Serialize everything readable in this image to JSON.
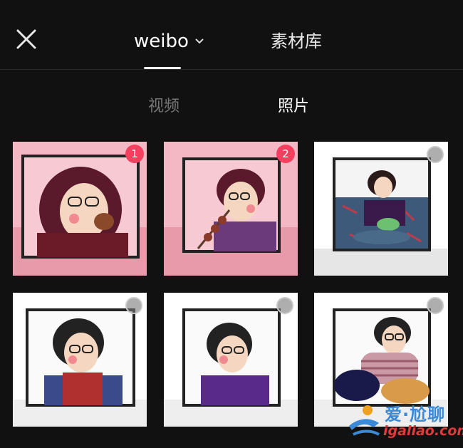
{
  "header": {
    "close_icon": "close-icon",
    "tabs": [
      {
        "label": "weibo",
        "active": true,
        "icon": "chevron-down-icon"
      },
      {
        "label": "素材库",
        "active": false
      }
    ]
  },
  "subtabs": [
    {
      "label": "视频",
      "active": false
    },
    {
      "label": "照片",
      "active": true
    }
  ],
  "photos": [
    {
      "selected": true,
      "badge": "1"
    },
    {
      "selected": true,
      "badge": "2"
    },
    {
      "selected": false,
      "badge": ""
    },
    {
      "selected": false,
      "badge": ""
    },
    {
      "selected": false,
      "badge": ""
    },
    {
      "selected": false,
      "badge": ""
    }
  ],
  "watermark": {
    "title": "爱·尬聊",
    "subtitle": "igaliao.com"
  },
  "colors": {
    "background": "#111111",
    "badge": "#f43f5e",
    "selected_tint": "#f4b8c4"
  }
}
